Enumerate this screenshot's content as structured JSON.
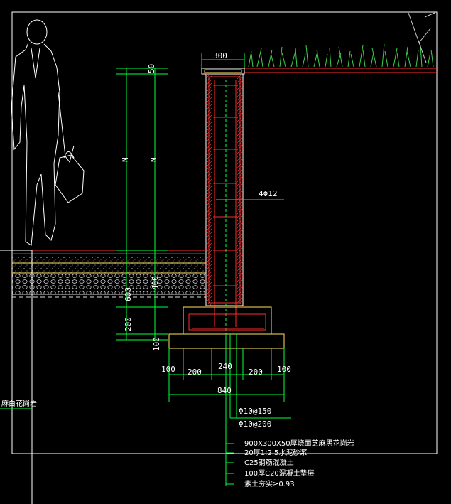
{
  "drawing": {
    "top_width": "300",
    "dim_v_left": {
      "cap": "50",
      "wall": "N",
      "base_total": "600",
      "footing": "200",
      "pad": "100"
    },
    "dim_v_inner": {
      "wall": "N",
      "lower": "400"
    },
    "rebar_main": "4Φ12",
    "stirrup_1": "Φ10@150",
    "stirrup_2": "Φ10@200",
    "bottom_dims": [
      "100",
      "200",
      "240",
      "200",
      "100"
    ],
    "bottom_total": "840",
    "left_label": "麻白花岗岩",
    "notes": [
      "900X300X50厚烧面芝麻黑花岗岩",
      "20厚1:2.5水泥砂浆",
      "C25钢筋混凝土",
      "100厚C20混凝土垫层",
      "素土夯实≥0.93"
    ],
    "colors": {
      "background": "#000000",
      "dimension": "#00ff3c",
      "outline": "#ffffff",
      "rebar": "#ff2a2a",
      "cap": "#ffe45a"
    }
  }
}
